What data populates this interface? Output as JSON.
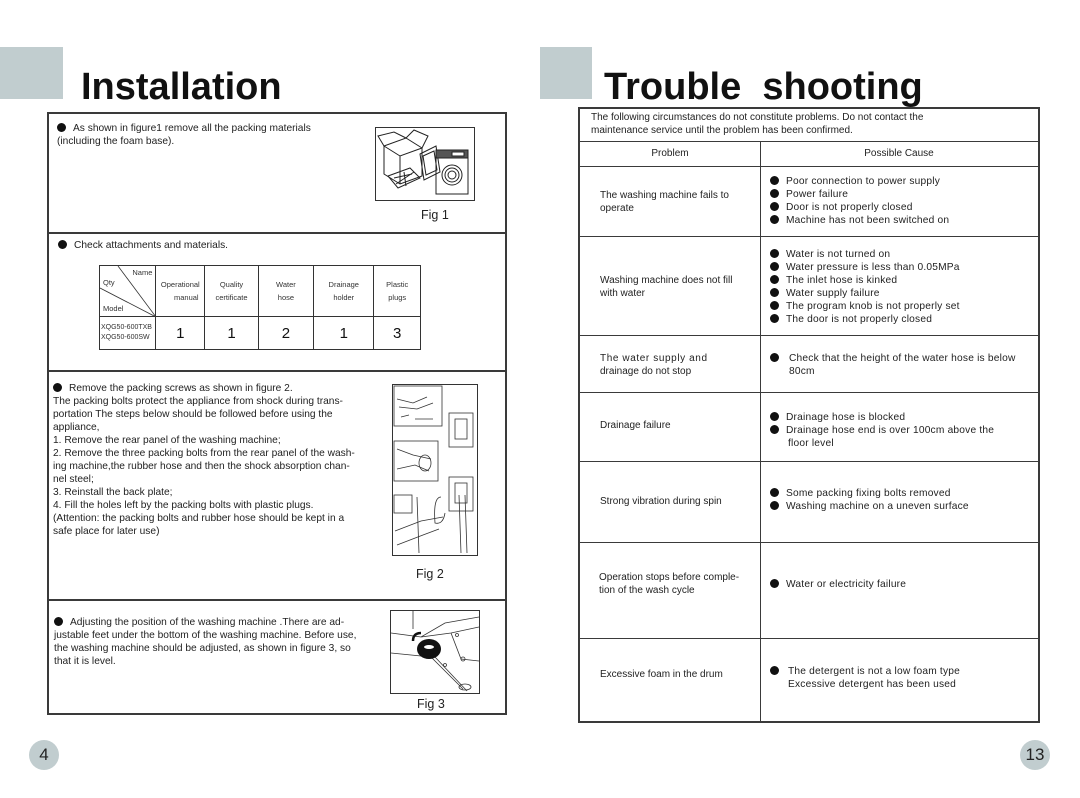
{
  "left_page": {
    "title": "Installation",
    "page_number": "4",
    "section1": {
      "text_line1": "As shown in figure1 remove all the packing materials",
      "text_line2": "(including the foam base).",
      "figure_caption": "Fig 1",
      "figure_icon": "washing-machine-unpacking-illustration"
    },
    "section2": {
      "text": "Check attachments and materials.",
      "table": {
        "corner_labels": {
          "name": "Name",
          "qty": "Qty",
          "model": "Model"
        },
        "columns": [
          {
            "line1": "Operational",
            "line2": "manual"
          },
          {
            "line1": "Quality",
            "line2": "certificate"
          },
          {
            "line1": "Water",
            "line2": "hose"
          },
          {
            "line1": "Drainage",
            "line2": "holder"
          },
          {
            "line1": "Plastic",
            "line2": "plugs"
          }
        ],
        "models": [
          "XQG50-600TXB",
          "XQG50-600SW"
        ],
        "quantities": [
          "1",
          "1",
          "2",
          "1",
          "3"
        ]
      }
    },
    "section3": {
      "lines": [
        "Remove the packing screws as shown in figure 2.",
        "The packing bolts protect the appliance from shock during trans-",
        "portation The steps below should be followed before using the",
        "appliance,",
        "1. Remove the rear panel of the washing machine;",
        "2. Remove the three packing bolts from the rear panel of the wash-",
        "ing machine,the rubber hose and then  the shock absorption chan-",
        "nel steel;",
        "3. Reinstall the back plate;",
        "4. Fill the holes left by the packing bolts with plastic plugs.",
        "(Attention: the packing bolts and rubber hose should be kept in a",
        "safe place for later use)"
      ],
      "figure_caption": "Fig 2",
      "figure_icon": "packing-bolt-removal-illustration"
    },
    "section4": {
      "lines": [
        "Adjusting the position of the washing machine .There are ad-",
        "justable feet under the bottom of the washing machine. Before use,",
        "the washing machine should be adjusted, as shown in figure 3, so",
        "that it is level."
      ],
      "figure_caption": "Fig 3",
      "figure_icon": "adjustable-foot-illustration"
    }
  },
  "right_page": {
    "title": "Trouble  shooting",
    "page_number": "13",
    "intro_line1": "The following circumstances do not constitute problems. Do not contact the",
    "intro_line2": "maintenance service until the problem has been confirmed.",
    "header": {
      "problem": "Problem",
      "cause": "Possible Cause"
    },
    "rows": [
      {
        "problem": [
          "The washing machine fails to",
          "operate"
        ],
        "causes": [
          "Poor connection to power supply",
          "Power failure",
          "Door is not properly closed",
          "Machine has not been switched on"
        ]
      },
      {
        "problem": [
          "Washing machine does not fill",
          "with water"
        ],
        "causes": [
          "Water is not turned on",
          "Water pressure is less than 0.05MPa",
          "The inlet hose is kinked",
          "Water supply failure",
          "The program knob is not properly set",
          "The door is not properly closed"
        ]
      },
      {
        "problem": [
          "The water supply and",
          "drainage do not stop"
        ],
        "causes": [
          "Check that the height of the water hose is below",
          "80cm"
        ]
      },
      {
        "problem": [
          "Drainage failure"
        ],
        "causes": [
          "Drainage hose is blocked",
          "Drainage hose end is over 100cm above the",
          "floor level"
        ]
      },
      {
        "problem": [
          "Strong vibration during spin"
        ],
        "causes": [
          "Some packing fixing bolts removed",
          "Washing machine on a uneven surface"
        ]
      },
      {
        "problem": [
          "Operation stops before comple-",
          "tion of the wash cycle"
        ],
        "causes": [
          "Water or electricity failure"
        ]
      },
      {
        "problem": [
          "Excessive foam in the drum"
        ],
        "causes": [
          "The detergent is not a low foam type",
          "Excessive detergent has been used"
        ]
      }
    ]
  },
  "colors": {
    "accent_gray": "#c1cdcf",
    "border": "#3a3a3a"
  }
}
